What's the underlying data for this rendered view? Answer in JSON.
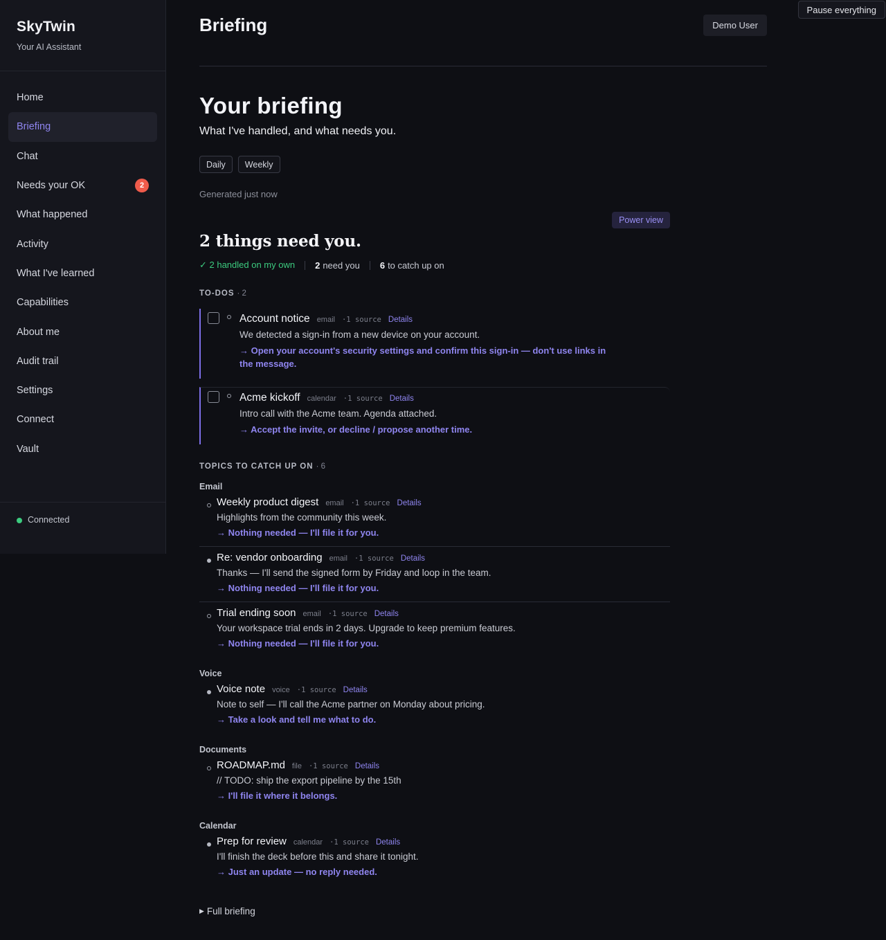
{
  "app": {
    "name": "SkyTwin",
    "subtitle": "Your AI Assistant"
  },
  "sidebar": {
    "items": [
      {
        "label": "Home"
      },
      {
        "label": "Briefing",
        "active": true
      },
      {
        "label": "Chat"
      },
      {
        "label": "Needs your OK",
        "badge": "2"
      },
      {
        "label": "What happened"
      },
      {
        "label": "Activity"
      },
      {
        "label": "What I've learned"
      },
      {
        "label": "Capabilities"
      },
      {
        "label": "About me"
      },
      {
        "label": "Audit trail"
      },
      {
        "label": "Settings"
      },
      {
        "label": "Connect"
      },
      {
        "label": "Vault"
      }
    ],
    "status": "Connected"
  },
  "topbar": {
    "pause_label": "Pause everything"
  },
  "header": {
    "title": "Briefing",
    "user": "Demo User"
  },
  "hero": {
    "title": "Your briefing",
    "subtitle": "What I've handled, and what needs you."
  },
  "tabs": [
    "Daily",
    "Weekly"
  ],
  "generated": "Generated just now",
  "power_view": "Power view",
  "summary": {
    "title": "2 things need you.",
    "handled": "✓ 2 handled on my own",
    "need_count": "2",
    "need_label": "need you",
    "catch_count": "6",
    "catch_label": "to catch up on"
  },
  "todos": {
    "label": "TO-DOS",
    "count": "· 2",
    "items": [
      {
        "title": "Account notice",
        "kind": "email",
        "sources": "·1 source",
        "details": "Details",
        "desc": "We detected a sign-in from a new device on your account.",
        "action": "→ Open your account's security settings and confirm this sign-in — don't use links in the message."
      },
      {
        "title": "Acme kickoff",
        "kind": "calendar",
        "sources": "·1 source",
        "details": "Details",
        "desc": "Intro call with the Acme team. Agenda attached.",
        "action": "→ Accept the invite, or decline / propose another time."
      }
    ]
  },
  "topics": {
    "label": "TOPICS TO CATCH UP ON",
    "count": "· 6",
    "groups": [
      {
        "label": "Email",
        "items": [
          {
            "title": "Weekly product digest",
            "kind": "email",
            "sources": "·1 source",
            "details": "Details",
            "desc": "Highlights from the community this week.",
            "action": "→ Nothing needed — I'll file it for you."
          },
          {
            "title": "Re: vendor onboarding",
            "kind": "email",
            "sources": "·1 source",
            "details": "Details",
            "desc": "Thanks — I'll send the signed form by Friday and loop in the team.",
            "action": "→ Nothing needed — I'll file it for you."
          },
          {
            "title": "Trial ending soon",
            "kind": "email",
            "sources": "·1 source",
            "details": "Details",
            "desc": "Your workspace trial ends in 2 days. Upgrade to keep premium features.",
            "action": "→ Nothing needed — I'll file it for you."
          }
        ]
      },
      {
        "label": "Voice",
        "items": [
          {
            "title": "Voice note",
            "kind": "voice",
            "sources": "·1 source",
            "details": "Details",
            "desc": "Note to self — I'll call the Acme partner on Monday about pricing.",
            "action": "→ Take a look and tell me what to do."
          }
        ]
      },
      {
        "label": "Documents",
        "items": [
          {
            "title": "ROADMAP.md",
            "kind": "file",
            "sources": "·1 source",
            "details": "Details",
            "desc": "// TODO: ship the export pipeline by the 15th",
            "action": "→ I'll file it where it belongs."
          }
        ]
      },
      {
        "label": "Calendar",
        "items": [
          {
            "title": "Prep for review",
            "kind": "calendar",
            "sources": "·1 source",
            "details": "Details",
            "desc": "I'll finish the deck before this and share it tonight.",
            "action": "→ Just an update — no reply needed."
          }
        ]
      }
    ]
  },
  "full_briefing": "Full briefing",
  "colors": {
    "accent": "#8f85ef",
    "success": "#3ccb7f",
    "badge": "#ef5b4b",
    "background": "#0e0f14",
    "sidebar": "#15161d"
  }
}
